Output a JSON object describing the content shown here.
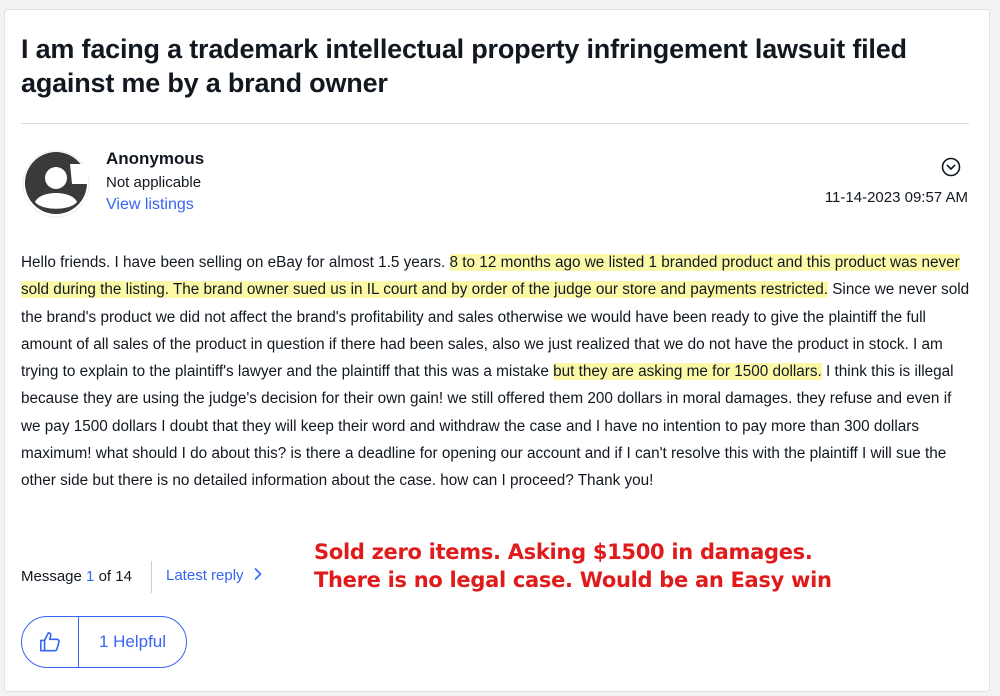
{
  "post": {
    "title": "I am facing a trademark intellectual property infringement lawsuit filed against me by a brand owner",
    "author": {
      "name": "Anonymous",
      "status": "Not applicable",
      "listings_link": "View listings"
    },
    "timestamp": "11-14-2023 09:57 AM",
    "body": [
      {
        "text": "Hello friends. I have been selling on eBay for almost 1.5 years. ",
        "highlight": false
      },
      {
        "text": "8 to 12 months ago we listed 1 branded product and this product was never sold during the listing. The brand owner sued us in IL court and by order of the judge our store and payments restricted.",
        "highlight": true
      },
      {
        "text": " Since we never sold the brand's product we did not affect the brand's profitability and sales otherwise we would have been ready to give the plaintiff the full amount of all sales of the product in question if there had been sales, also we just realized that we do not have the product in stock. I am trying to explain to the plaintiff's lawyer and the plaintiff that this was a mistake ",
        "highlight": false
      },
      {
        "text": "but they are asking me for 1500 dollars.",
        "highlight": true
      },
      {
        "text": " I think this is illegal because they are using the judge's decision for their own gain! we still offered them 200 dollars in moral damages. they refuse and even if we pay 1500 dollars I doubt that they will keep their word and withdraw the case and I have no intention to pay more than 300 dollars maximum! what should I do about this? is there a deadline for opening our account and if I can't resolve this with the plaintiff I will sue the other side but there is no detailed information about the case. how can I proceed? Thank you!",
        "highlight": false
      }
    ]
  },
  "footer": {
    "message_prefix": "Message",
    "message_number": "1",
    "message_suffix": "of 14",
    "latest_reply": "Latest reply",
    "helpful_label": "1 Helpful"
  },
  "annotation": {
    "line1": "Sold zero items. Asking $1500 in damages.",
    "line2": "There is no legal case. Would be an Easy win"
  },
  "icons": {
    "menu": "chevron-down-circle-icon",
    "thumb": "thumbs-up-icon",
    "avatar": "default-avatar-icon",
    "latest": "chevron-right-icon"
  },
  "colors": {
    "link": "#3665f3",
    "highlight": "#fbf9a8",
    "annotation": "#e01b1b"
  }
}
